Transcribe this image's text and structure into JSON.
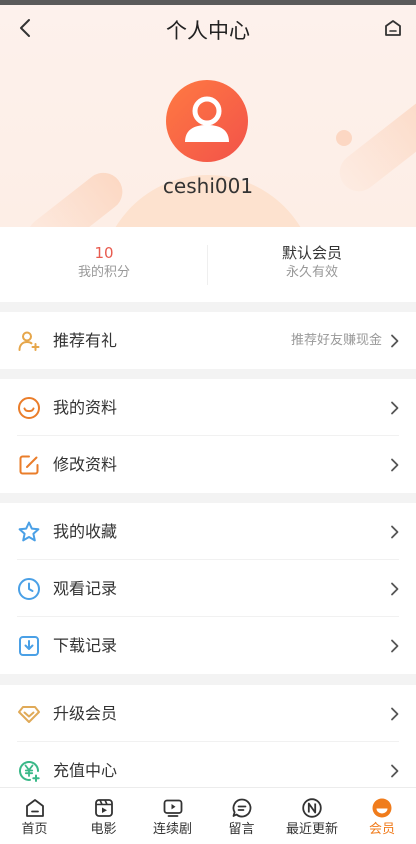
{
  "header": {
    "title": "个人中心"
  },
  "profile": {
    "username": "ceshi001"
  },
  "stats": {
    "points_value": "10",
    "points_label": "我的积分",
    "member_value": "默认会员",
    "member_label": "永久有效"
  },
  "menu": {
    "referral": {
      "label": "推荐有礼",
      "sub": "推荐好友赚现金"
    },
    "my_profile": {
      "label": "我的资料"
    },
    "edit_profile": {
      "label": "修改资料"
    },
    "favorites": {
      "label": "我的收藏"
    },
    "history": {
      "label": "观看记录"
    },
    "downloads": {
      "label": "下载记录"
    },
    "upgrade": {
      "label": "升级会员"
    },
    "recharge": {
      "label": "充值中心"
    }
  },
  "tabs": [
    {
      "label": "首页",
      "icon": "home-icon"
    },
    {
      "label": "电影",
      "icon": "movie-icon"
    },
    {
      "label": "连续剧",
      "icon": "tv-series-icon"
    },
    {
      "label": "留言",
      "icon": "message-icon"
    },
    {
      "label": "最近更新",
      "icon": "new-icon"
    },
    {
      "label": "会员",
      "icon": "member-icon",
      "active": true
    }
  ],
  "colors": {
    "accent": "#f07c1c",
    "avatar": "#f2524a",
    "points": "#e85b4f"
  }
}
